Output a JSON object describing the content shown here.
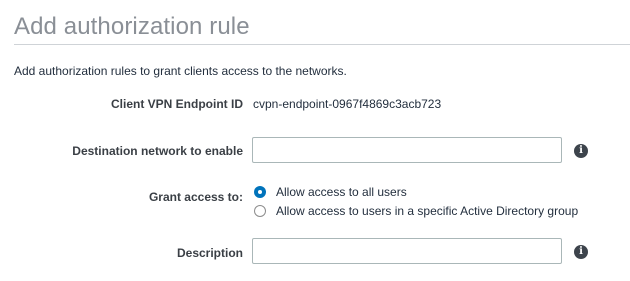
{
  "page": {
    "title": "Add authorization rule",
    "intro": "Add authorization rules to grant clients access to the networks."
  },
  "form": {
    "endpoint": {
      "label": "Client VPN Endpoint ID",
      "value": "cvpn-endpoint-0967f4869c3acb723"
    },
    "destination": {
      "label": "Destination network to enable",
      "value": "",
      "info_icon": "info-icon"
    },
    "grant_access": {
      "label": "Grant access to:",
      "options": [
        {
          "label": "Allow access to all users",
          "selected": true
        },
        {
          "label": "Allow access to users in a specific Active Directory group",
          "selected": false
        }
      ]
    },
    "description": {
      "label": "Description",
      "value": "",
      "info_icon": "info-icon"
    }
  },
  "colors": {
    "title": "#8a8f96",
    "radio_selected": "#0073bb",
    "info_icon": "#3d444c"
  }
}
